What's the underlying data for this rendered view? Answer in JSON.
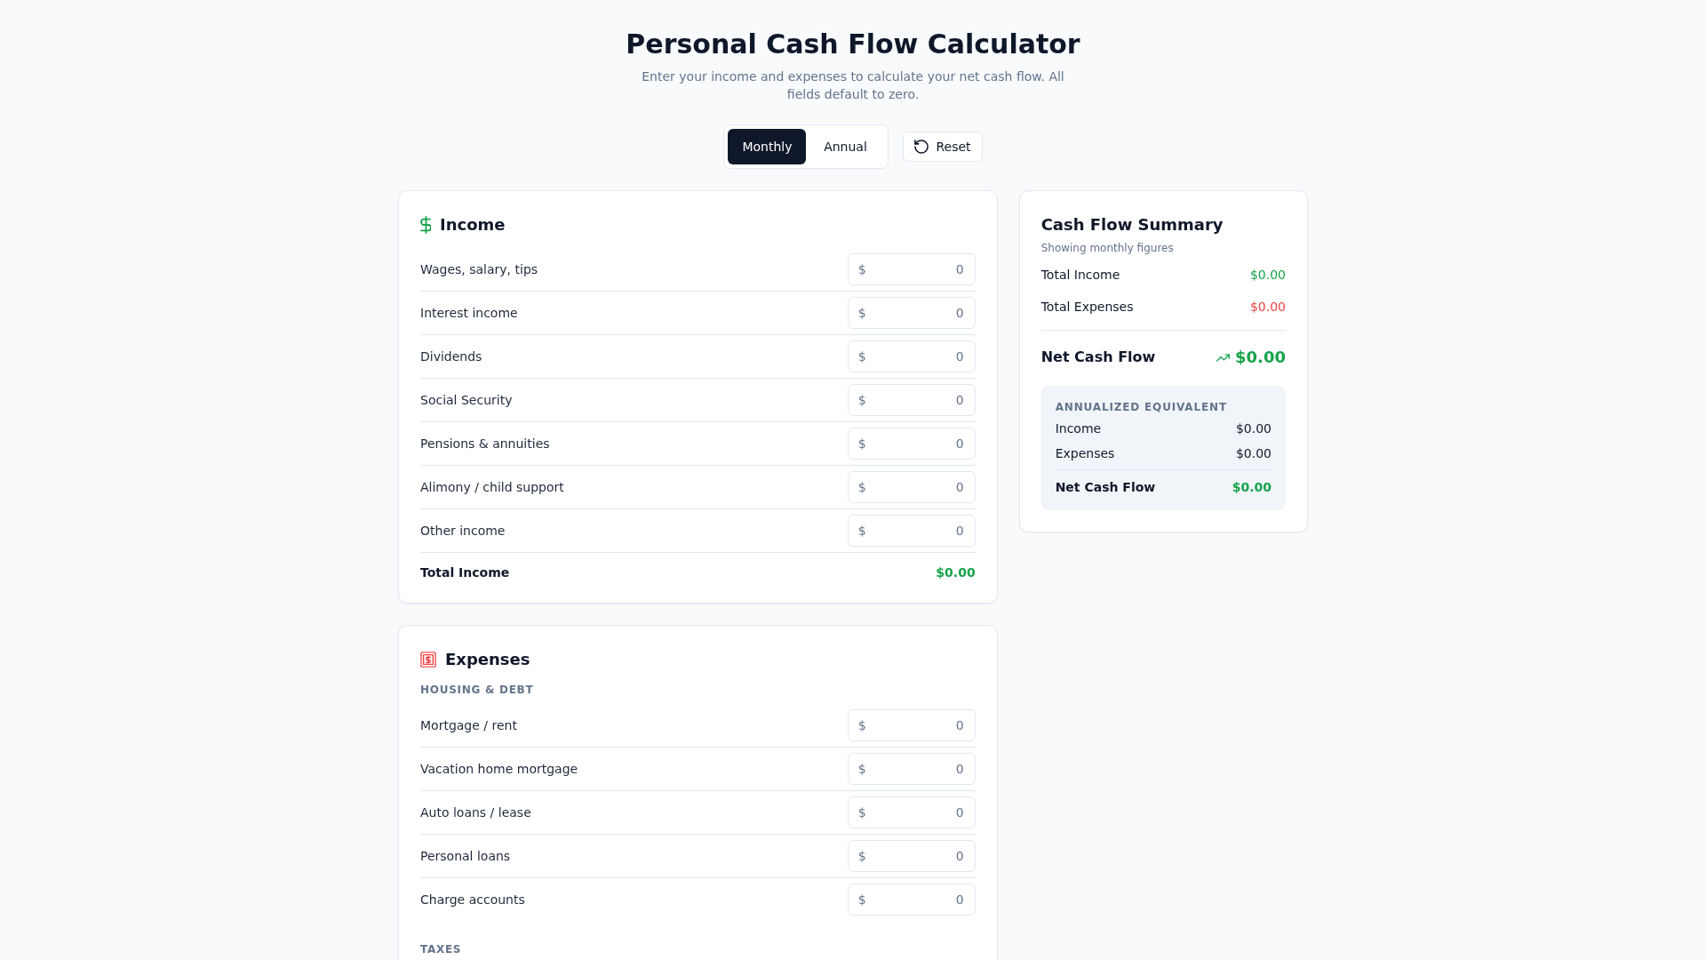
{
  "header": {
    "title": "Personal Cash Flow Calculator",
    "subtitle": "Enter your income and expenses to calculate your net cash flow. All fields default to zero."
  },
  "period_tabs": [
    {
      "label": "Monthly",
      "selected": true
    },
    {
      "label": "Annual",
      "selected": false
    }
  ],
  "reset_button": {
    "label": "Reset"
  },
  "income": {
    "title": "Income",
    "rows": [
      {
        "label": "Wages, salary, tips",
        "prefix": "$",
        "placeholder": "0"
      },
      {
        "label": "Interest income",
        "prefix": "$",
        "placeholder": "0"
      },
      {
        "label": "Dividends",
        "prefix": "$",
        "placeholder": "0"
      },
      {
        "label": "Social Security",
        "prefix": "$",
        "placeholder": "0"
      },
      {
        "label": "Pensions & annuities",
        "prefix": "$",
        "placeholder": "0"
      },
      {
        "label": "Alimony / child support",
        "prefix": "$",
        "placeholder": "0"
      },
      {
        "label": "Other income",
        "prefix": "$",
        "placeholder": "0"
      }
    ],
    "total": {
      "label": "Total Income",
      "value": "$0.00"
    }
  },
  "expenses": {
    "title": "Expenses",
    "sections": [
      {
        "heading": "HOUSING & DEBT",
        "rows": [
          {
            "label": "Mortgage / rent",
            "prefix": "$",
            "placeholder": "0"
          },
          {
            "label": "Vacation home mortgage",
            "prefix": "$",
            "placeholder": "0"
          },
          {
            "label": "Auto loans / lease",
            "prefix": "$",
            "placeholder": "0"
          },
          {
            "label": "Personal loans",
            "prefix": "$",
            "placeholder": "0"
          },
          {
            "label": "Charge accounts",
            "prefix": "$",
            "placeholder": "0"
          }
        ]
      },
      {
        "heading": "TAXES"
      }
    ]
  },
  "summary": {
    "title": "Cash Flow Summary",
    "note": "Showing monthly figures",
    "lines": [
      {
        "label": "Total Income",
        "value": "$0.00",
        "color": "#16a34a"
      },
      {
        "label": "Total Expenses",
        "value": "$0.00",
        "color": "#ef4444"
      }
    ],
    "net": {
      "label": "Net Cash Flow",
      "value": "$0.00"
    },
    "annualized": {
      "heading": "ANNUALIZED EQUIVALENT",
      "lines": [
        {
          "label": "Income",
          "value": "$0.00"
        },
        {
          "label": "Expenses",
          "value": "$0.00"
        }
      ],
      "net": {
        "label": "Net Cash Flow",
        "value": "$0.00"
      }
    }
  }
}
